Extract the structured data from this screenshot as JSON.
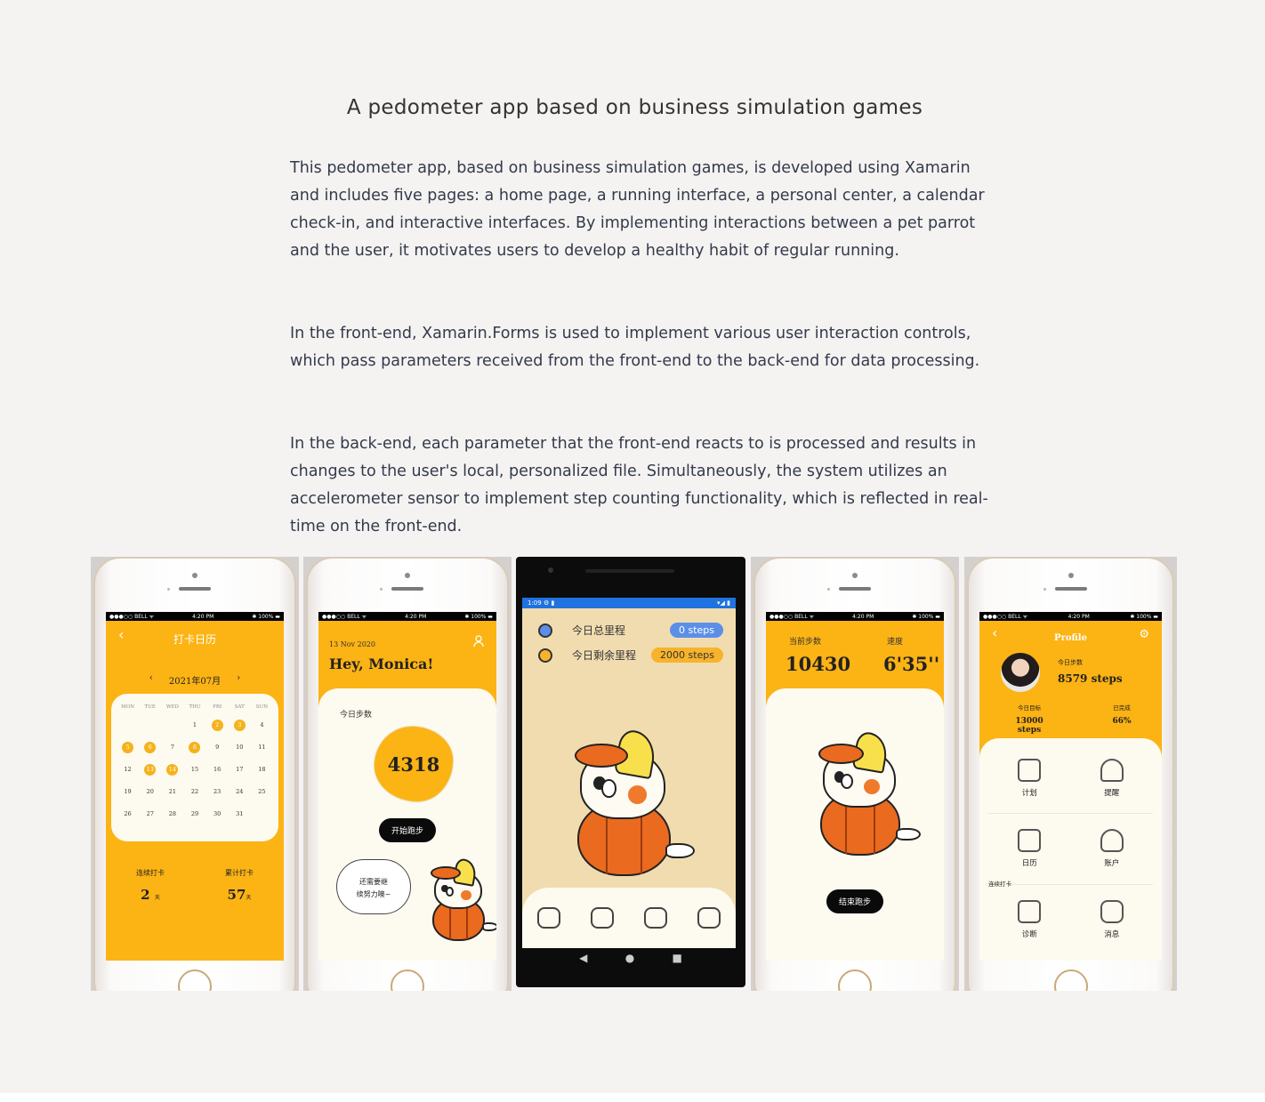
{
  "title": "A pedometer app based on business simulation games",
  "paragraphs": [
    "This pedometer app, based on business simulation games, is developed using Xamarin and includes five pages: a home page, a running interface, a personal center, a calendar check-in, and interactive interfaces. By implementing interactions between a pet parrot and the user, it motivates users to develop a healthy habit of regular running.",
    "In the front-end, Xamarin.Forms is used to implement various user interaction controls, which pass parameters received from the front-end to the back-end for data processing.",
    "In the back-end, each parameter that the front-end reacts to is processed and results in changes to the user's local, personalized file. Simultaneously, the system utilizes an accelerometer sensor to implement step counting functionality, which is reflected in real-time on the front-end."
  ],
  "status": {
    "carrier": "●●●○○ BELL ᯤ",
    "time": "4:20 PM",
    "battery": "✱ 100% ▬"
  },
  "calendar": {
    "title": "打卡日历",
    "month": "2021年07月",
    "weekdays": [
      "MON",
      "TUE",
      "WED",
      "THU",
      "FRI",
      "SAT",
      "SUN"
    ],
    "days": [
      "",
      "",
      "",
      "1",
      "2",
      "3",
      "4",
      "5",
      "6",
      "7",
      "8",
      "9",
      "10",
      "11",
      "12",
      "13",
      "14",
      "15",
      "16",
      "17",
      "18",
      "19",
      "20",
      "21",
      "22",
      "23",
      "24",
      "25",
      "26",
      "27",
      "28",
      "29",
      "30",
      "31",
      "",
      "",
      "",
      ""
    ],
    "highlighted": [
      "2",
      "3",
      "5",
      "6",
      "8",
      "13",
      "14"
    ],
    "streak_label": "连续打卡",
    "streak_value": "2",
    "streak_unit": "天",
    "total_label": "累计打卡",
    "total_value": "57",
    "total_unit": "天"
  },
  "home": {
    "date": "13 Nov 2020",
    "greeting": "Hey, Monica!",
    "steps_label": "今日步数",
    "steps": "4318",
    "start_button": "开始跑步",
    "bubble_line1": "还需要继",
    "bubble_line2": "续努力噢~"
  },
  "android": {
    "time": "1:09 ⚙ ▮",
    "icons": "▾◢ ▮",
    "total_label": "今日总里程",
    "total_value": "0 steps",
    "remain_label": "今日剩余里程",
    "remain_value": "2000 steps",
    "nav": [
      "◀",
      "●",
      "■"
    ],
    "colors": {
      "blue_chip": "#5b8fe8",
      "orange_chip": "#f7b32b"
    }
  },
  "running": {
    "steps_label": "当前步数",
    "steps": "10430",
    "speed_label": "速度",
    "speed": "6'35''",
    "end_button": "结束跑步"
  },
  "profile": {
    "title": "Profile",
    "today_steps_label": "今日步数",
    "today_steps": "8579 steps",
    "goal_label": "今日目标",
    "goal": "13000 steps",
    "done_label": "已完成",
    "done": "66%",
    "streak_note": "连续打卡",
    "menu": [
      {
        "label": "计划",
        "icon": "edit-icon"
      },
      {
        "label": "提醒",
        "icon": "bell-icon"
      },
      {
        "label": "日历",
        "icon": "calendar-icon"
      },
      {
        "label": "账户",
        "icon": "account-icon"
      },
      {
        "label": "诊断",
        "icon": "diagnosis-icon"
      },
      {
        "label": "消息",
        "icon": "message-icon"
      }
    ]
  },
  "colors": {
    "accent": "#fcb314",
    "cream": "#fdfaef",
    "background": "#f5f3f2"
  }
}
